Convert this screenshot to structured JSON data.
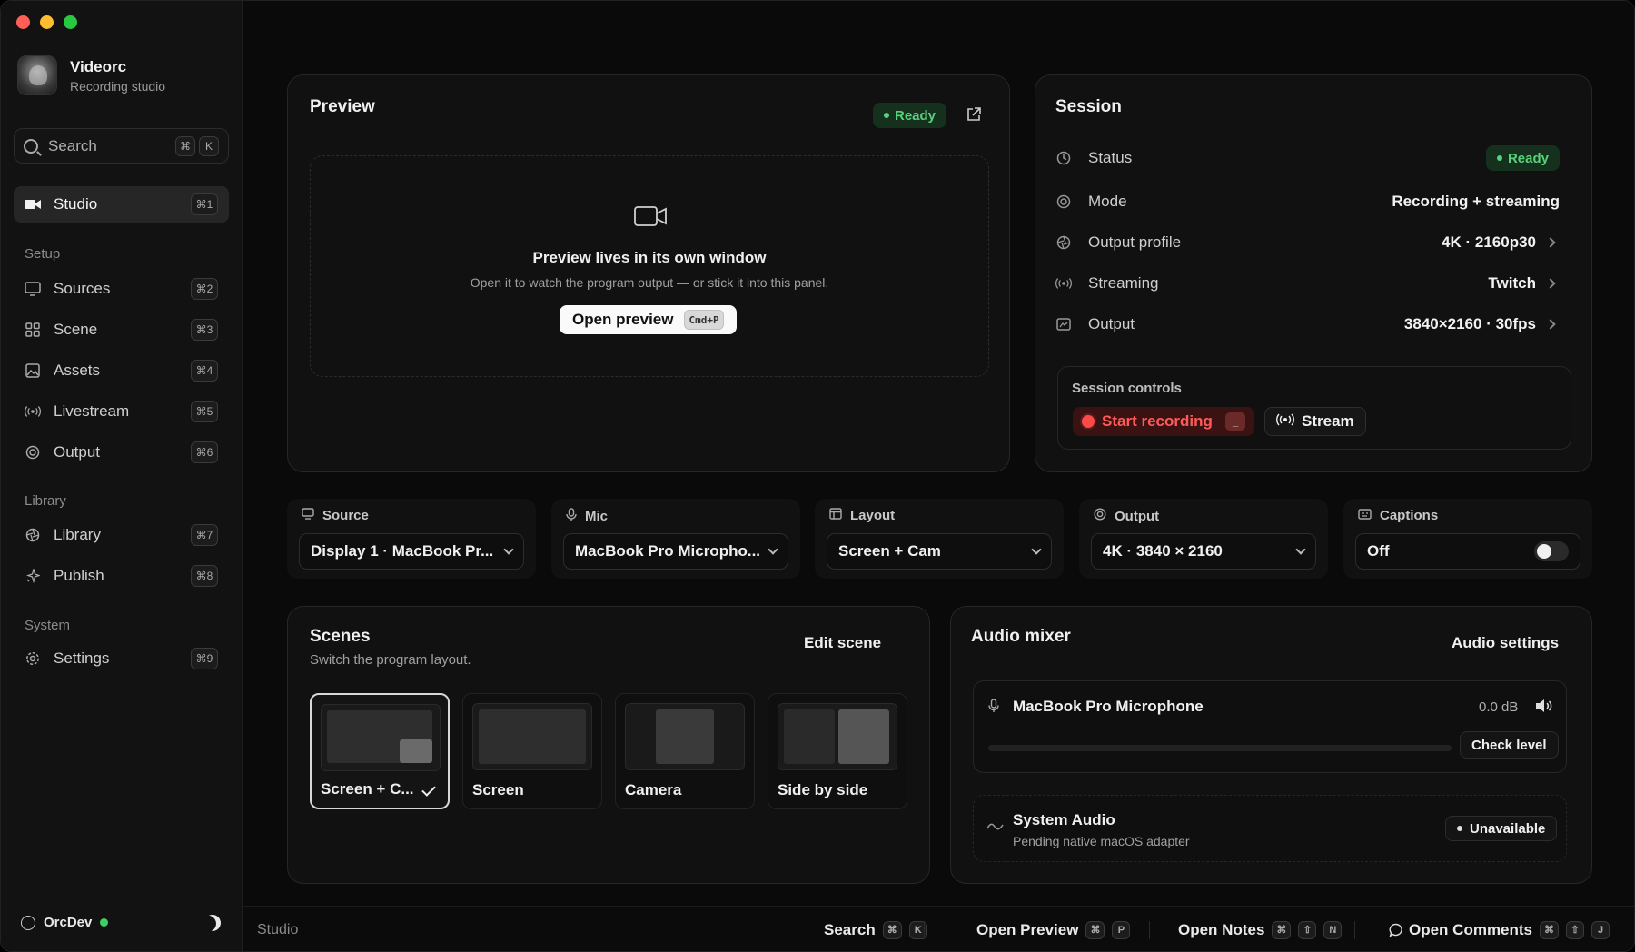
{
  "app": {
    "name": "Videorc",
    "subtitle": "Recording studio"
  },
  "search": {
    "label": "Search",
    "shortcut_mod": "⌘",
    "shortcut_key": "K"
  },
  "sidebar": {
    "studio": {
      "label": "Studio",
      "shortcut": "⌘1"
    },
    "sections": {
      "setup": "Setup",
      "library": "Library",
      "system": "System"
    },
    "items": [
      {
        "label": "Sources",
        "shortcut": "⌘2",
        "icon": "monitor-icon"
      },
      {
        "label": "Scene",
        "shortcut": "⌘3",
        "icon": "grid-icon"
      },
      {
        "label": "Assets",
        "shortcut": "⌘4",
        "icon": "image-icon"
      },
      {
        "label": "Livestream",
        "shortcut": "⌘5",
        "icon": "broadcast-icon"
      },
      {
        "label": "Output",
        "shortcut": "⌘6",
        "icon": "target-icon"
      },
      {
        "label": "Library",
        "shortcut": "⌘7",
        "icon": "aperture-icon"
      },
      {
        "label": "Publish",
        "shortcut": "⌘8",
        "icon": "sparkle-icon"
      },
      {
        "label": "Settings",
        "shortcut": "⌘9",
        "icon": "gear-icon"
      }
    ],
    "user": {
      "name": "OrcDev",
      "online": true
    }
  },
  "preview": {
    "title": "Preview",
    "status": "Ready",
    "headline": "Preview lives in its own window",
    "description": "Open it to watch the program output — or stick it into this panel.",
    "open_button": "Open preview",
    "open_shortcut": "Cmd+P"
  },
  "session": {
    "title": "Session",
    "rows": [
      {
        "label": "Status",
        "value": "Ready",
        "icon": "clock-icon"
      },
      {
        "label": "Mode",
        "value": "Recording + streaming",
        "icon": "target-icon"
      },
      {
        "label": "Output profile",
        "value": "4K · 2160p30",
        "icon": "aperture-icon"
      },
      {
        "label": "Streaming",
        "value": "Twitch",
        "icon": "broadcast-icon"
      },
      {
        "label": "Output",
        "value": "3840×2160 · 30fps",
        "icon": "monitor-icon"
      }
    ],
    "controls_title": "Session controls",
    "start_recording": "Start recording",
    "stream": "Stream"
  },
  "selectors": [
    {
      "label": "Source",
      "value": "Display 1 · MacBook Pr...",
      "icon": "monitor-icon"
    },
    {
      "label": "Mic",
      "value": "MacBook Pro Micropho...",
      "icon": "mic-icon"
    },
    {
      "label": "Layout",
      "value": "Screen + Cam",
      "icon": "layout-icon"
    },
    {
      "label": "Output",
      "value": "4K · 3840 × 2160",
      "icon": "target-icon"
    },
    {
      "label": "Captions",
      "value": "Off",
      "icon": "captions-icon",
      "toggle_on": false
    }
  ],
  "scenes": {
    "title": "Scenes",
    "subtitle": "Switch the program layout.",
    "edit": "Edit scene",
    "items": [
      {
        "name": "Screen + C...",
        "selected": true
      },
      {
        "name": "Screen",
        "selected": false
      },
      {
        "name": "Camera",
        "selected": false
      },
      {
        "name": "Side by side",
        "selected": false
      }
    ]
  },
  "audio": {
    "title": "Audio mixer",
    "settings": "Audio settings",
    "mic": {
      "name": "MacBook Pro Microphone",
      "level": "0.0 dB",
      "check": "Check level",
      "meter_fraction": 0
    },
    "system": {
      "name": "System Audio",
      "note": "Pending native macOS adapter",
      "status": "Unavailable"
    }
  },
  "statusbar": {
    "location": "Studio",
    "items": [
      {
        "label": "Search",
        "keys": [
          "⌘",
          "K"
        ]
      },
      {
        "label": "Open Preview",
        "keys": [
          "⌘",
          "P"
        ]
      },
      {
        "label": "Open Notes",
        "keys": [
          "⌘",
          "⇧",
          "N"
        ]
      },
      {
        "label": "Open Comments",
        "keys": [
          "⌘",
          "⇧",
          "J"
        ]
      }
    ]
  },
  "colors": {
    "accent_green": "#58d17b",
    "record_red": "#ff4a4a",
    "background": "#0a0a0a"
  }
}
